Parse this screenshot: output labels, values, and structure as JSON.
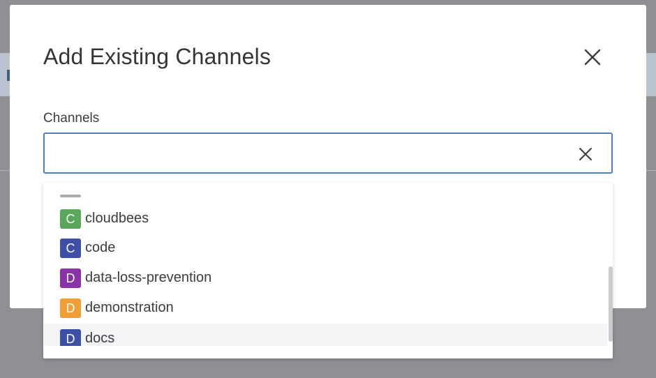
{
  "modal": {
    "title": "Add Existing Channels",
    "field_label": "Channels",
    "input_value": "",
    "input_placeholder": ""
  },
  "dropdown": {
    "items": [
      {
        "initial": "C",
        "label": "cloudbees",
        "color": "#5aa75b"
      },
      {
        "initial": "C",
        "label": "code",
        "color": "#3e4fa6"
      },
      {
        "initial": "D",
        "label": "data-loss-prevention",
        "color": "#8a33a8"
      },
      {
        "initial": "D",
        "label": "demonstration",
        "color": "#f09e36"
      },
      {
        "initial": "D",
        "label": "docs",
        "color": "#3e4fa6"
      }
    ]
  },
  "colors": {
    "overlay": "#8f9093",
    "focus_border": "#4a7fd0",
    "highlight_row": "#f3f4f6"
  },
  "icons": {
    "close": "close-icon",
    "clear": "clear-icon"
  }
}
